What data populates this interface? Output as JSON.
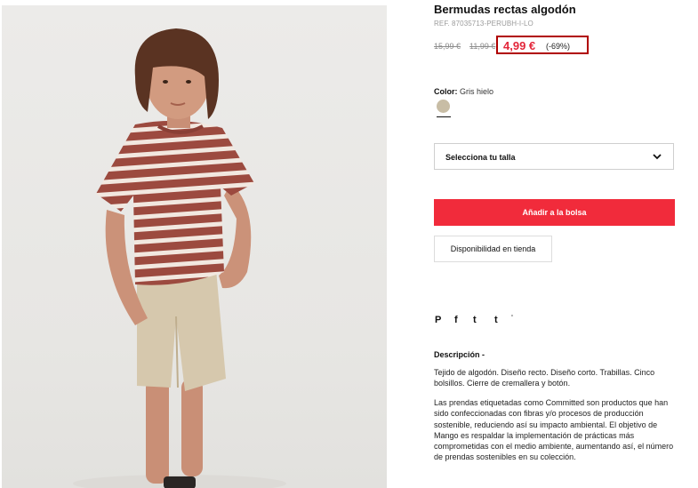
{
  "product": {
    "title": "Bermudas rectas algodón",
    "ref": "REF. 87035713-PERUBH-I-LO"
  },
  "pricing": {
    "old_price_1": "15,99 €",
    "old_price_2": "11,99 €",
    "current_price": "4,99 €",
    "discount": "(-69%)",
    "price_color": "#e3263a",
    "highlight_border_color": "#b00000"
  },
  "color": {
    "label": "Color:",
    "value": "Gris hielo",
    "swatch_hex": "#c8bda5"
  },
  "size_select": {
    "label": "Selecciona tu talla"
  },
  "buttons": {
    "add_to_bag": "Añadir a la bolsa",
    "add_to_bag_color": "#f12b3b",
    "store_availability": "Disponibilidad en tienda"
  },
  "social": {
    "pinterest": "P",
    "facebook": "f",
    "twitter": "t",
    "tumblr": "t",
    "more": "'",
    "icons": [
      "pinterest-icon",
      "facebook-icon",
      "twitter-icon",
      "tumblr-icon",
      "more-icon"
    ]
  },
  "description": {
    "heading": "Descripción -",
    "paragraph_1": "Tejido de algodón. Diseño recto. Diseño corto. Trabillas. Cinco bolsillos. Cierre de cremallera y botón.",
    "paragraph_2": "Las prendas etiquetadas como Committed son productos que han sido confeccionadas con fibras y/o procesos de producción sostenible, reduciendo así su impacto ambiental. El objetivo de Mango es respaldar la implementación de prácticas más comprometidas con el medio ambiente, aumentando así, el número de prendas sostenibles en su colección."
  }
}
